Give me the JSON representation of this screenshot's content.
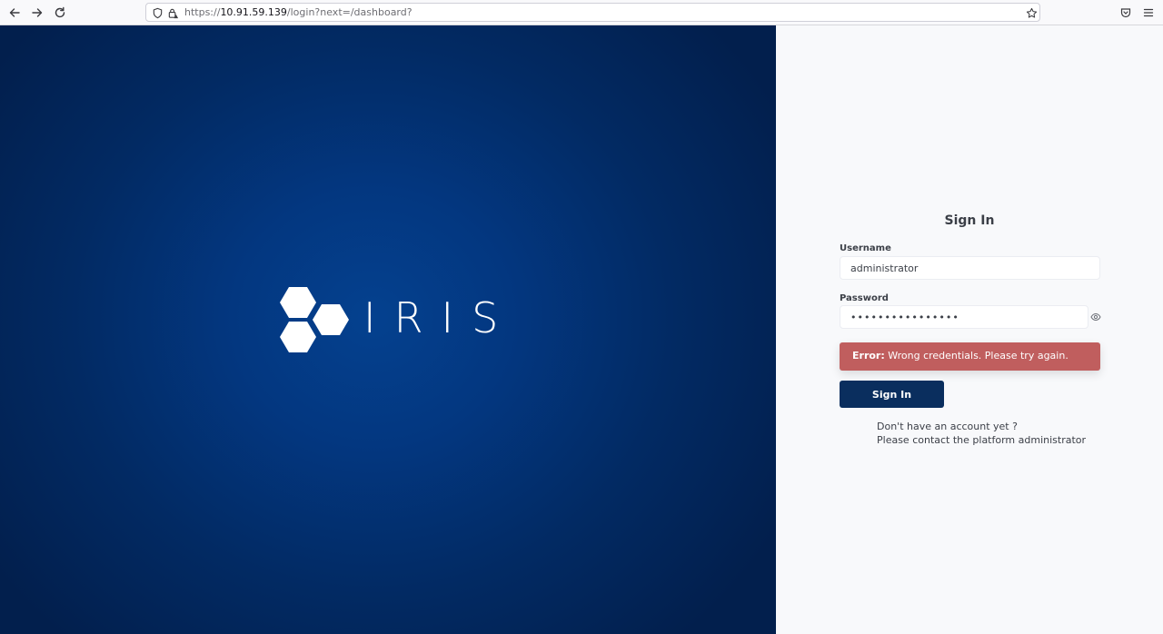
{
  "browser": {
    "url_prefix": "https://",
    "url_host": "10.91.59.139",
    "url_path": "/login?next=/dashboard?"
  },
  "hero": {
    "logo_text": "IRIS",
    "background": "#033780"
  },
  "form": {
    "title": "Sign In",
    "username_label": "Username",
    "username_value": "administrator",
    "password_label": "Password",
    "password_value": "••••••••••••••••",
    "error_prefix": "Error:",
    "error_message": " Wrong credentials. Please try again.",
    "submit_label": "Sign In",
    "help_line1": "Don't have an account yet ?",
    "help_line2": "Please contact the platform administrator"
  },
  "colors": {
    "accent": "#0a2e5e",
    "error": "#c05e5e",
    "panel": "#f8f9fb"
  }
}
